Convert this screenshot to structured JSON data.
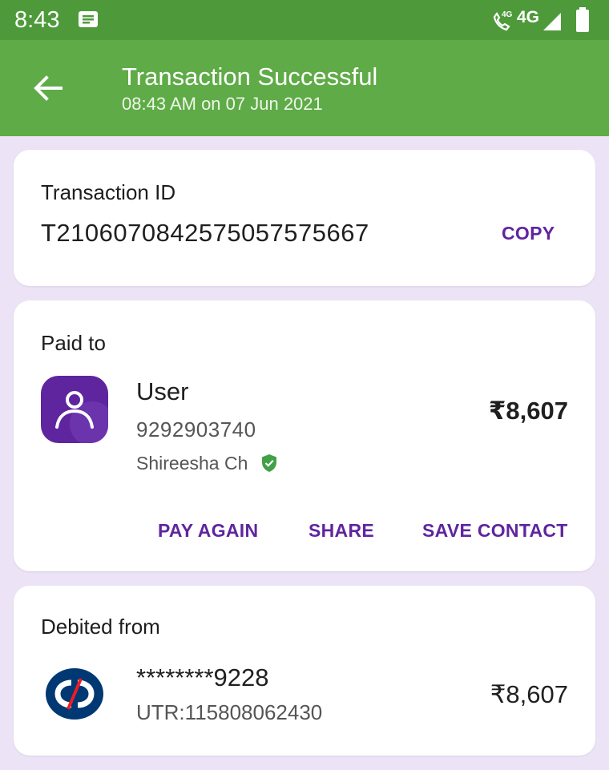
{
  "status_bar": {
    "time": "8:43",
    "network_small": "4G",
    "network": "4G",
    "icons": [
      "notification-icon",
      "volte-call-icon",
      "signal-icon",
      "battery-icon"
    ]
  },
  "app_bar": {
    "title": "Transaction Successful",
    "subtitle": "08:43 AM on 07 Jun 2021",
    "background": "#5fab47"
  },
  "transaction": {
    "label": "Transaction ID",
    "id": "T2106070842575057575667",
    "copy_label": "COPY"
  },
  "paid_to": {
    "label": "Paid to",
    "name": "User",
    "phone": "9292903740",
    "holder": "Shireesha Ch",
    "amount": "₹8,607",
    "actions": {
      "pay_again": "PAY AGAIN",
      "share": "SHARE",
      "save_contact": "SAVE CONTACT"
    }
  },
  "debited_from": {
    "label": "Debited from",
    "account": "********9228",
    "utr": "UTR:115808062430",
    "amount": "₹8,607"
  },
  "colors": {
    "accent": "#5f259f",
    "status_bar": "#4e9a3a",
    "page_background": "#ece3f6",
    "verified": "#43a047",
    "bank_logo": "#003874",
    "bank_logo_accent": "#ed1c24"
  }
}
